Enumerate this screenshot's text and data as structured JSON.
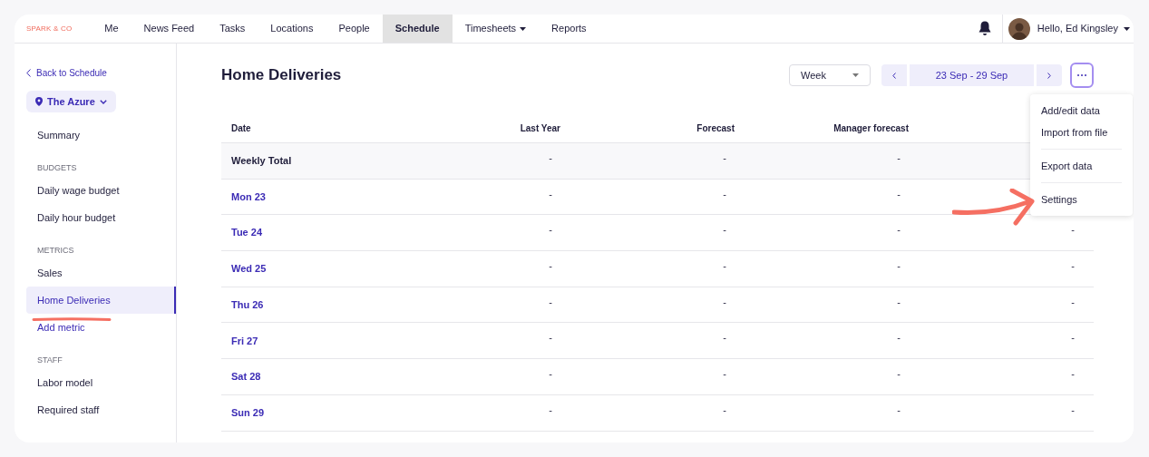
{
  "brand": "SPARK & CO",
  "nav": [
    {
      "label": "Me",
      "selected": false
    },
    {
      "label": "News Feed",
      "selected": false
    },
    {
      "label": "Tasks",
      "selected": false
    },
    {
      "label": "Locations",
      "selected": false
    },
    {
      "label": "People",
      "selected": false
    },
    {
      "label": "Schedule",
      "selected": true
    },
    {
      "label": "Timesheets",
      "selected": false,
      "dropdown": true
    },
    {
      "label": "Reports",
      "selected": false
    }
  ],
  "user": {
    "greeting": "Hello, Ed Kingsley"
  },
  "sidebar": {
    "back": "Back to Schedule",
    "location": "The Azure",
    "sections": [
      {
        "items": [
          {
            "label": "Summary",
            "selected": false,
            "kind": "item"
          }
        ]
      },
      {
        "heading": "BUDGETS",
        "items": [
          {
            "label": "Daily wage budget",
            "selected": false,
            "kind": "item"
          },
          {
            "label": "Daily hour budget",
            "selected": false,
            "kind": "item"
          }
        ]
      },
      {
        "heading": "METRICS",
        "items": [
          {
            "label": "Sales",
            "selected": false,
            "kind": "item"
          },
          {
            "label": "Home Deliveries",
            "selected": true,
            "kind": "item"
          },
          {
            "label": "Add metric",
            "selected": false,
            "kind": "link"
          }
        ]
      },
      {
        "heading": "STAFF",
        "items": [
          {
            "label": "Labor model",
            "selected": false,
            "kind": "item"
          },
          {
            "label": "Required staff",
            "selected": false,
            "kind": "item"
          }
        ]
      }
    ]
  },
  "title": "Home Deliveries",
  "period": {
    "value": "Week"
  },
  "range": "23 Sep - 29 Sep",
  "menu": {
    "items": [
      {
        "label": "Add/edit data",
        "divider_after": false
      },
      {
        "label": "Import from file",
        "divider_after": true
      },
      {
        "label": "Export data",
        "divider_after": true
      },
      {
        "label": "Settings",
        "divider_after": false
      }
    ]
  },
  "table": {
    "columns": [
      "Date",
      "Last Year",
      "Forecast",
      "Manager forecast"
    ],
    "rows": [
      {
        "kind": "total",
        "cells": [
          "Weekly Total",
          "-",
          "-",
          "-"
        ]
      },
      {
        "kind": "day",
        "cells": [
          "Mon 23",
          "-",
          "-",
          "-"
        ]
      },
      {
        "kind": "day",
        "cells": [
          "Tue 24",
          "-",
          "-",
          "-",
          "-"
        ]
      },
      {
        "kind": "day",
        "cells": [
          "Wed 25",
          "-",
          "-",
          "-",
          "-"
        ]
      },
      {
        "kind": "day",
        "cells": [
          "Thu 26",
          "-",
          "-",
          "-",
          "-"
        ]
      },
      {
        "kind": "day",
        "cells": [
          "Fri 27",
          "-",
          "-",
          "-",
          "-"
        ]
      },
      {
        "kind": "day",
        "cells": [
          "Sat 28",
          "-",
          "-",
          "-",
          "-"
        ]
      },
      {
        "kind": "day",
        "cells": [
          "Sun 29",
          "-",
          "-",
          "-",
          "-"
        ]
      }
    ]
  }
}
